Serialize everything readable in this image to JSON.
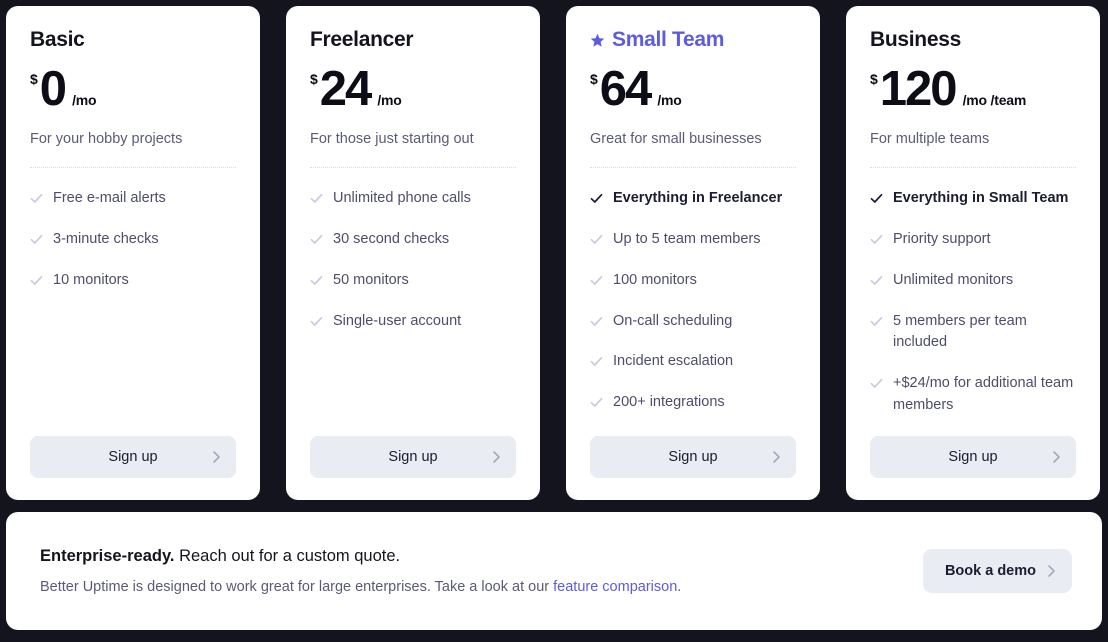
{
  "theme": {
    "background": "#14141f",
    "card_bg": "#ffffff",
    "accent": "#5c5ce0",
    "button_bg": "#e9ecf2",
    "text_dark": "#14141f",
    "text_muted": "#5a5a78",
    "check_muted": "#c9cbdd"
  },
  "plans": [
    {
      "name": "Basic",
      "featured": false,
      "star_icon": "star-icon",
      "currency": "$",
      "amount": "0",
      "period": "/mo",
      "tagline": "For your hobby projects",
      "features": [
        {
          "label": "Free e-mail alerts",
          "strong": false,
          "icon": "check-icon"
        },
        {
          "label": "3-minute checks",
          "strong": false,
          "icon": "check-icon"
        },
        {
          "label": "10 monitors",
          "strong": false,
          "icon": "check-icon"
        }
      ],
      "cta": {
        "label": "Sign up",
        "icon": "chevron-right-icon"
      }
    },
    {
      "name": "Freelancer",
      "featured": false,
      "star_icon": "star-icon",
      "currency": "$",
      "amount": "24",
      "period": "/mo",
      "tagline": "For those just starting out",
      "features": [
        {
          "label": "Unlimited phone calls",
          "strong": false,
          "icon": "check-icon"
        },
        {
          "label": "30 second checks",
          "strong": false,
          "icon": "check-icon"
        },
        {
          "label": "50 monitors",
          "strong": false,
          "icon": "check-icon"
        },
        {
          "label": "Single-user account",
          "strong": false,
          "icon": "check-icon"
        }
      ],
      "cta": {
        "label": "Sign up",
        "icon": "chevron-right-icon"
      }
    },
    {
      "name": "Small Team",
      "featured": true,
      "star_icon": "star-icon",
      "currency": "$",
      "amount": "64",
      "period": "/mo",
      "tagline": "Great for small businesses",
      "features": [
        {
          "label": "Everything in Freelancer",
          "strong": true,
          "icon": "check-icon"
        },
        {
          "label": "Up to 5 team members",
          "strong": false,
          "icon": "check-icon"
        },
        {
          "label": "100 monitors",
          "strong": false,
          "icon": "check-icon"
        },
        {
          "label": "On-call scheduling",
          "strong": false,
          "icon": "check-icon"
        },
        {
          "label": "Incident escalation",
          "strong": false,
          "icon": "check-icon"
        },
        {
          "label": "200+ integrations",
          "strong": false,
          "icon": "check-icon"
        }
      ],
      "cta": {
        "label": "Sign up",
        "icon": "chevron-right-icon"
      }
    },
    {
      "name": "Business",
      "featured": false,
      "star_icon": "star-icon",
      "currency": "$",
      "amount": "120",
      "period": "/mo /team",
      "tagline": "For multiple teams",
      "features": [
        {
          "label": "Everything in Small Team",
          "strong": true,
          "icon": "check-icon"
        },
        {
          "label": "Priority support",
          "strong": false,
          "icon": "check-icon"
        },
        {
          "label": "Unlimited monitors",
          "strong": false,
          "icon": "check-icon"
        },
        {
          "label": "5 members per team included",
          "strong": false,
          "icon": "check-icon"
        },
        {
          "label": "+$24/mo for additional team members",
          "strong": false,
          "icon": "check-icon"
        }
      ],
      "cta": {
        "label": "Sign up",
        "icon": "chevron-right-icon"
      }
    }
  ],
  "enterprise": {
    "headline_bold": "Enterprise-ready.",
    "headline_rest": " Reach out for a custom quote.",
    "sub_before": "Better Uptime is designed to work great for large enterprises. Take a look at our ",
    "sub_link": "feature comparison",
    "sub_after": ".",
    "cta": {
      "label": "Book a demo",
      "icon": "chevron-right-icon"
    }
  }
}
